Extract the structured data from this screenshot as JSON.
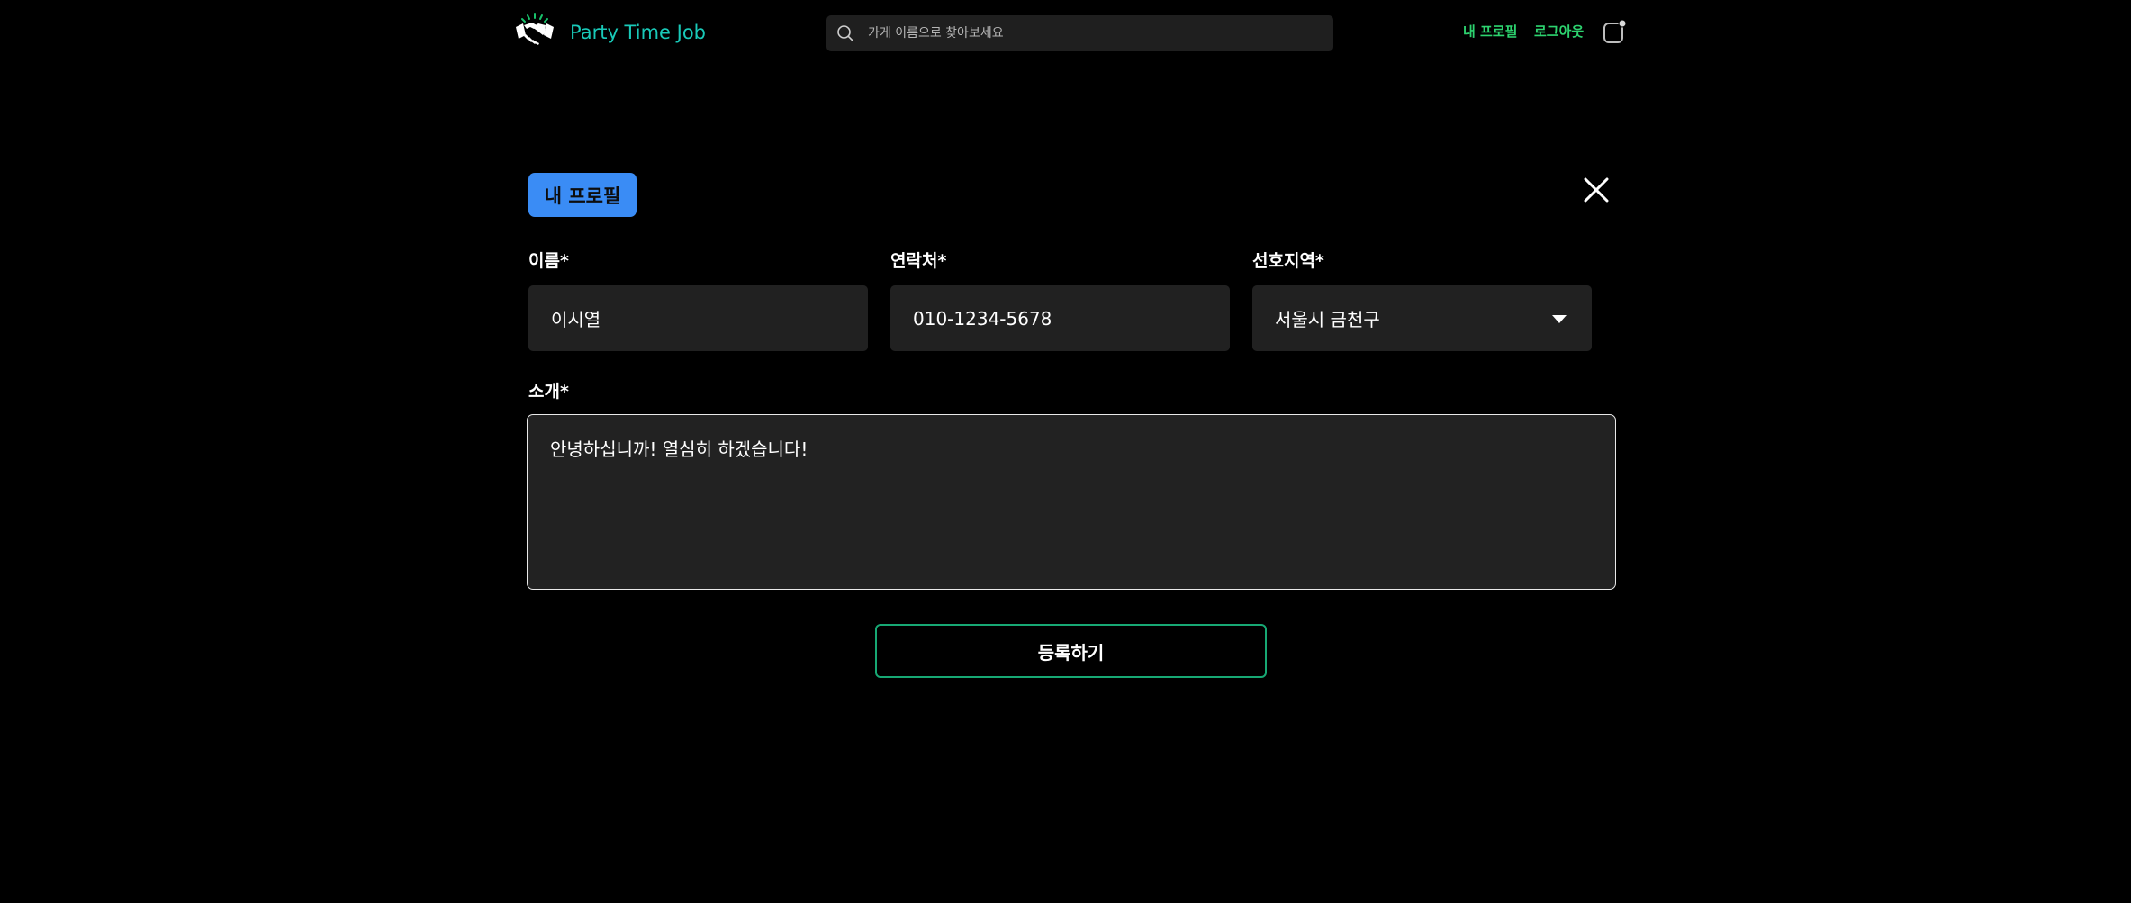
{
  "header": {
    "logo_text": "Party Time Job",
    "logo_icon": "handshake-icon",
    "search": {
      "icon": "search-icon",
      "placeholder": "가게 이름으로 찾아보세요",
      "value": ""
    },
    "nav": {
      "profile_label": "내 프로필",
      "logout_label": "로그아웃"
    },
    "notification_icon": "bell-icon"
  },
  "form": {
    "badge": "내 프로필",
    "close_icon": "close-icon",
    "name": {
      "label": "이름*",
      "value": "이시열"
    },
    "phone": {
      "label": "연락처*",
      "value": "010-1234-5678"
    },
    "region": {
      "label": "선호지역*",
      "selected": "서울시 금천구",
      "icon": "chevron-down-icon"
    },
    "intro": {
      "label": "소개*",
      "value": "안녕하십니까! 열심히 하겠습니다!"
    },
    "submit_label": "등록하기"
  },
  "colors": {
    "background": "#000000",
    "brand_text": "#19c9b8",
    "nav_link": "#2dd36f",
    "badge": "#3a8cf5",
    "input_bg": "#212121",
    "submit_border": "#17a874"
  }
}
